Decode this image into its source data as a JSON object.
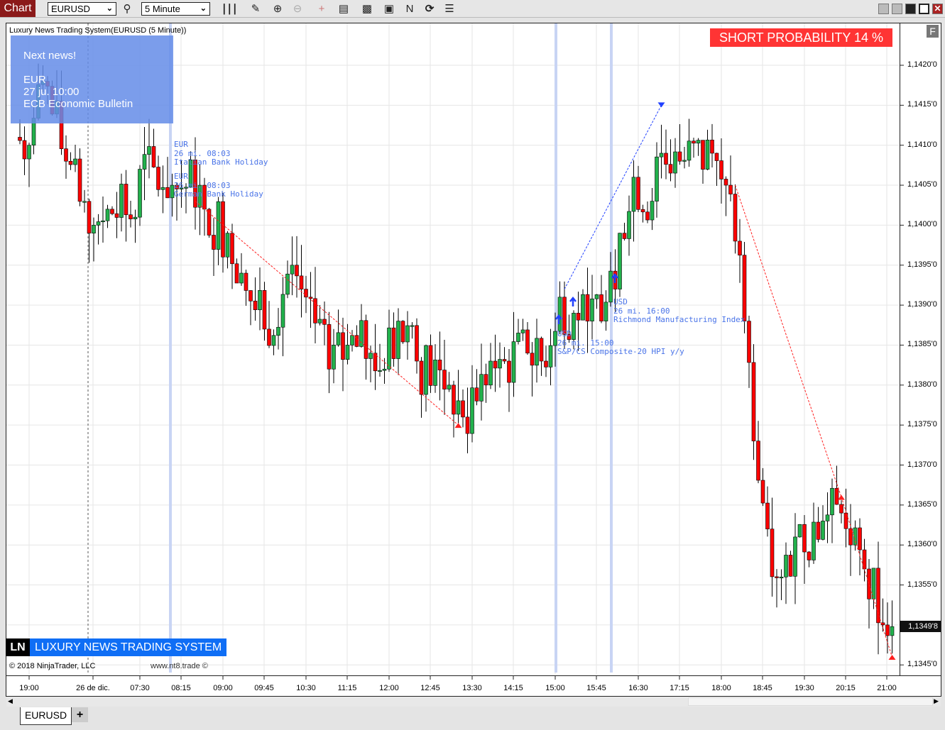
{
  "toolbar": {
    "chart_tab": "Chart",
    "instrument": "EURUSD",
    "interval": "5 Minute",
    "icons": [
      "search-icon",
      "bar-type-icon",
      "pencil-icon",
      "zoom-in-icon",
      "zoom-out-icon",
      "crosshair-icon",
      "data-box-icon",
      "indicators-icon",
      "strategies-icon",
      "drawing-tools-icon",
      "reload-icon",
      "properties-icon"
    ]
  },
  "chart": {
    "title": "Luxury News Trading System(EURUSD (5 Minute))",
    "next_news": {
      "heading": "Next news!",
      "currency": "EUR",
      "time": "27 ju. 10:00",
      "event": "ECB Economic Bulletin"
    },
    "short_probability": "SHORT PROBABILITY 14 %",
    "f_button": "F",
    "annotations": [
      {
        "currency": "EUR",
        "time": "26 mi. 08:03",
        "event": "Italian Bank Holiday"
      },
      {
        "currency": "EUR",
        "time": "26 mi. 08:03",
        "event": "German Bank Holiday"
      },
      {
        "currency": "USD",
        "time": "26 mi. 15:00",
        "event": "S&P/CS Composite-20 HPI y/y"
      },
      {
        "currency": "USD",
        "time": "26 mi. 16:00",
        "event": "Richmond Manufacturing Index"
      }
    ],
    "brand": {
      "logo": "LN",
      "name": "LUXURY NEWS TRADING SYSTEM"
    },
    "copyright": "© 2018 NinjaTrader, LLC",
    "site": "www.nt8.trade ©",
    "current_price": "1,1349'8",
    "colors": {
      "up": "#22b14c",
      "down": "#ff0000",
      "news_band": "#c8d4f4",
      "short_box": "#ff3434",
      "brand": "#0f6ef5"
    }
  },
  "price_axis": [
    "1,1420'0",
    "1,1415'0",
    "1,1410'0",
    "1,1405'0",
    "1,1400'0",
    "1,1395'0",
    "1,1390'0",
    "1,1385'0",
    "1,1380'0",
    "1,1375'0",
    "1,1370'0",
    "1,1365'0",
    "1,1360'0",
    "1,1355'0",
    "1,1350'0",
    "1,1345'0"
  ],
  "time_axis": [
    "19:00",
    "26 de dic.",
    "07:30",
    "08:15",
    "09:00",
    "09:45",
    "10:30",
    "11:15",
    "12:00",
    "12:45",
    "13:30",
    "14:15",
    "15:00",
    "15:45",
    "16:30",
    "17:15",
    "18:00",
    "18:45",
    "19:30",
    "20:15",
    "21:00"
  ],
  "tabs": [
    {
      "label": "EURUSD"
    },
    {
      "label": "+"
    }
  ],
  "chart_data": {
    "type": "candlestick",
    "symbol": "EURUSD",
    "interval": "5 Minute",
    "ylim": [
      1.1345,
      1.1422
    ],
    "close_path": [
      [
        1,
        "18:45",
        1.1411
      ],
      [
        1,
        "19:00",
        1.141
      ],
      [
        1,
        "19:15",
        1.1418
      ],
      [
        1,
        "19:40",
        1.1408
      ],
      [
        1,
        "20:05",
        1.1399
      ],
      [
        2,
        "06:40",
        1.14
      ],
      [
        2,
        "06:55",
        1.1402
      ],
      [
        2,
        "07:25",
        1.1401
      ],
      [
        2,
        "07:30",
        1.1407
      ],
      [
        2,
        "08:05",
        1.1405
      ],
      [
        2,
        "08:35",
        1.1405
      ],
      [
        2,
        "08:40",
        1.1402
      ],
      [
        2,
        "09:05",
        1.1399
      ],
      [
        2,
        "09:20",
        1.1394
      ],
      [
        2,
        "09:45",
        1.1387
      ],
      [
        2,
        "10:15",
        1.1395
      ],
      [
        2,
        "10:30",
        1.1391
      ],
      [
        2,
        "10:55",
        1.1382
      ],
      [
        2,
        "11:15",
        1.1385
      ],
      [
        2,
        "11:40",
        1.1384
      ],
      [
        2,
        "11:55",
        1.1382
      ],
      [
        2,
        "12:10",
        1.1388
      ],
      [
        2,
        "12:30",
        1.1383
      ],
      [
        2,
        "13:05",
        1.138
      ],
      [
        2,
        "13:20",
        1.1376
      ],
      [
        2,
        "13:35",
        1.1378
      ],
      [
        2,
        "13:50",
        1.1383
      ],
      [
        2,
        "14:05",
        1.1383
      ],
      [
        2,
        "14:30",
        1.1384
      ],
      [
        2,
        "14:45",
        1.1383
      ],
      [
        2,
        "15:05",
        1.1391
      ],
      [
        2,
        "15:20",
        1.1389
      ],
      [
        2,
        "15:35",
        1.1388
      ],
      [
        2,
        "15:50",
        1.1388
      ],
      [
        2,
        "16:05",
        1.1392
      ],
      [
        2,
        "16:10",
        1.1399
      ],
      [
        2,
        "16:25",
        1.1406
      ],
      [
        2,
        "16:45",
        1.1403
      ],
      [
        2,
        "16:55",
        1.1409
      ],
      [
        2,
        "17:15",
        1.1408
      ],
      [
        2,
        "17:50",
        1.1409
      ],
      [
        2,
        "18:05",
        1.1405
      ],
      [
        2,
        "18:15",
        1.1398
      ],
      [
        2,
        "18:25",
        1.1388
      ],
      [
        2,
        "18:35",
        1.1373
      ],
      [
        2,
        "18:50",
        1.1362
      ],
      [
        2,
        "19:05",
        1.1356
      ],
      [
        2,
        "19:20",
        1.1361
      ],
      [
        2,
        "19:50",
        1.1363
      ],
      [
        2,
        "20:10",
        1.1364
      ],
      [
        2,
        "20:20",
        1.136
      ],
      [
        2,
        "20:35",
        1.1357
      ],
      [
        2,
        "20:55",
        1.135
      ],
      [
        2,
        "21:05",
        1.13498
      ]
    ],
    "signals": [
      {
        "type": "short",
        "from": [
          2,
          "08:30",
          1.1403
        ],
        "to": [
          2,
          "13:15",
          1.1375
        ]
      },
      {
        "type": "long",
        "from": [
          2,
          "15:10",
          1.1392
        ],
        "to": [
          2,
          "16:55",
          1.1415
        ]
      },
      {
        "type": "short",
        "from": [
          2,
          "18:15",
          1.1405
        ],
        "to": [
          2,
          "20:10",
          1.1366
        ]
      },
      {
        "type": "short",
        "from": [
          2,
          "20:10",
          1.1366
        ],
        "to": [
          2,
          "21:05",
          1.1346
        ]
      }
    ]
  }
}
